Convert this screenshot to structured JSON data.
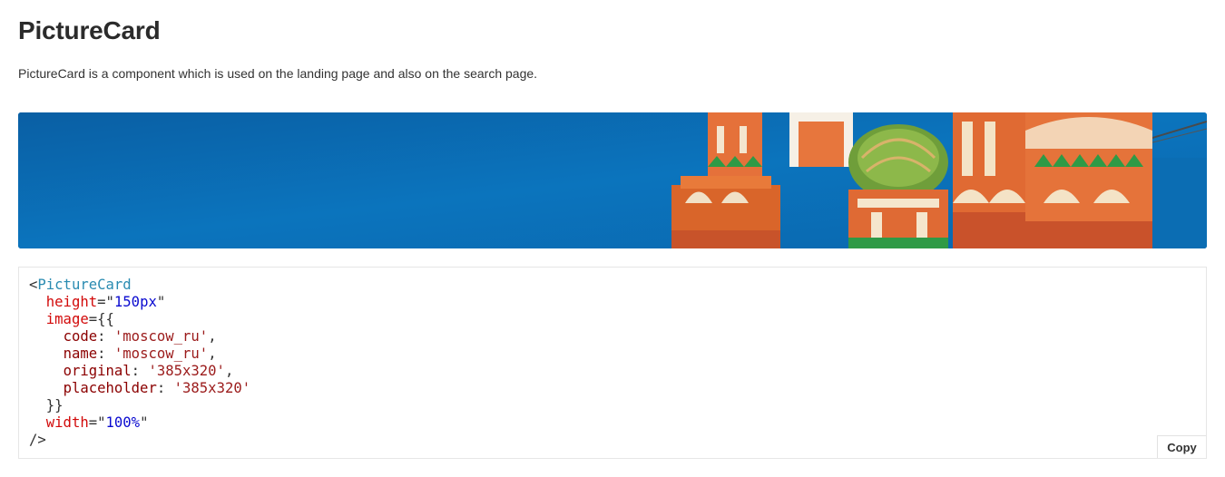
{
  "header": {
    "title": "PictureCard",
    "description": "PictureCard is a component which is used on the landing page and also on the search page."
  },
  "picture_card": {
    "image_subject": "Saint Basil's Cathedral, Moscow",
    "sky_color": "#0a6fb5"
  },
  "code_example": {
    "lt": "<",
    "component": "PictureCard",
    "attr_height": "height",
    "eq_quote": "=\"",
    "height_value": "150px",
    "close_quote": "\"",
    "attr_image": "image",
    "image_open": "={{",
    "key_code": "code",
    "value_code": "'moscow_ru'",
    "key_name": "name",
    "value_name": "'moscow_ru'",
    "key_original": "original",
    "value_original": "'385x320'",
    "key_placeholder": "placeholder",
    "value_placeholder": "'385x320'",
    "colon": ": ",
    "comma": ",",
    "image_close": "}}",
    "attr_width": "width",
    "width_value": "100%",
    "self_close": "/>"
  },
  "actions": {
    "copy_label": "Copy"
  }
}
